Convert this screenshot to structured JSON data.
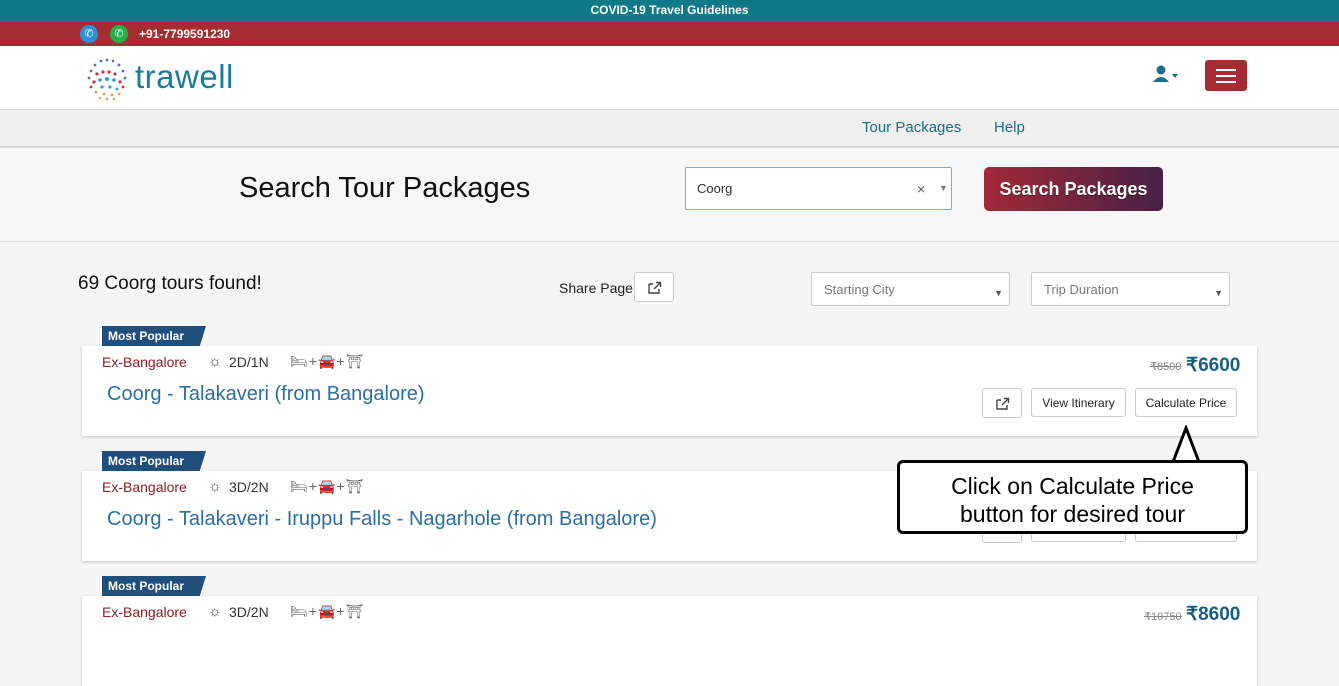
{
  "top_banner": {
    "text": "COVID-19 Travel Guidelines"
  },
  "contact": {
    "phone": "+91-7799591230"
  },
  "brand": {
    "name": "trawell"
  },
  "nav": {
    "items": [
      "Tour Packages",
      "Help"
    ]
  },
  "search": {
    "title": "Search Tour Packages",
    "value": "Coorg",
    "clear": "×",
    "button_label": "Search Packages"
  },
  "results": {
    "count_text": "69 Coorg tours found!",
    "share_label": "Share Page",
    "filters": [
      "Starting City",
      "Trip Duration"
    ]
  },
  "cards": [
    {
      "badge": "Most Popular",
      "origin": "Ex-Bangalore",
      "duration": "2D/1N",
      "title": "Coorg - Talakaveri (from Bangalore)",
      "old_price": "₹8500",
      "price": "₹6600"
    },
    {
      "badge": "Most Popular",
      "origin": "Ex-Bangalore",
      "duration": "3D/2N",
      "title": "Coorg - Talakaveri - Iruppu Falls - Nagarhole (from Bangalore)"
    },
    {
      "badge": "Most Popular",
      "origin": "Ex-Bangalore",
      "duration": "3D/2N",
      "old_price": "₹10750",
      "price": "₹8600"
    }
  ],
  "card_buttons": {
    "view": "View Itinerary",
    "calc": "Calculate Price"
  },
  "callout": {
    "line1": "Click on Calculate Price",
    "line2": "button for desired tour"
  },
  "colors": {
    "teal": "#0e7a87",
    "maroon": "#a52d31",
    "link_blue": "#2b6fa3"
  }
}
